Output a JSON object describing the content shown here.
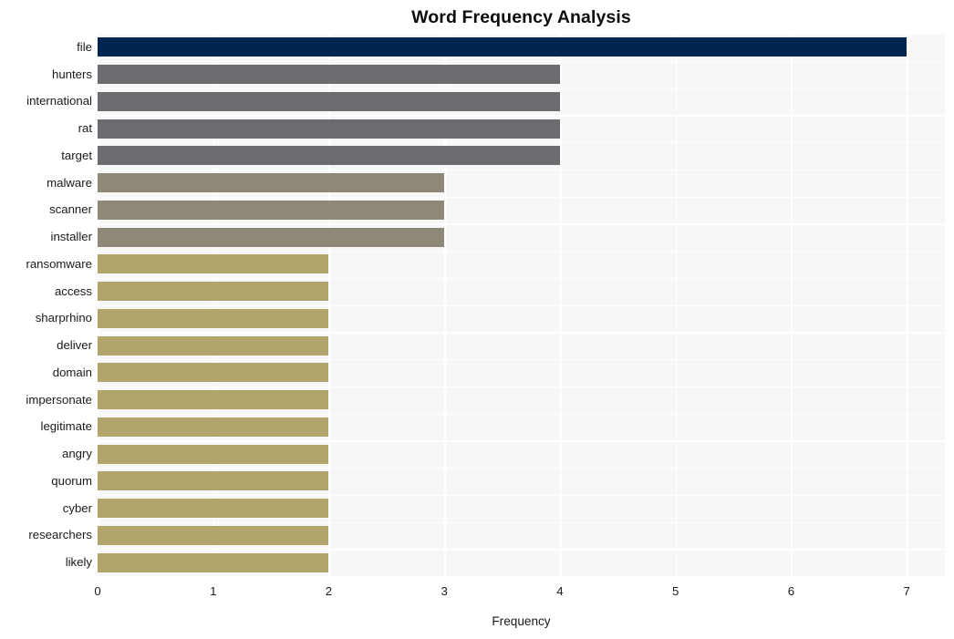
{
  "chart_data": {
    "type": "bar",
    "orientation": "horizontal",
    "title": "Word Frequency Analysis",
    "xlabel": "Frequency",
    "ylabel": "",
    "xlim": [
      0,
      7.33
    ],
    "xticks": [
      0,
      1,
      2,
      3,
      4,
      5,
      6,
      7
    ],
    "xtick_labels": [
      "0",
      "1",
      "2",
      "3",
      "4",
      "5",
      "6",
      "7"
    ],
    "grid": "vertical-and-horizontal-white-on-light-gray",
    "legend": "none",
    "categories": [
      "file",
      "hunters",
      "international",
      "rat",
      "target",
      "malware",
      "scanner",
      "installer",
      "ransomware",
      "access",
      "sharprhino",
      "deliver",
      "domain",
      "impersonate",
      "legitimate",
      "angry",
      "quorum",
      "cyber",
      "researchers",
      "likely"
    ],
    "values": [
      7,
      4,
      4,
      4,
      4,
      3,
      3,
      3,
      2,
      2,
      2,
      2,
      2,
      2,
      2,
      2,
      2,
      2,
      2,
      2
    ],
    "bar_colors": [
      "#00254f",
      "#6a6c70",
      "#6a6c70",
      "#6a6c70",
      "#6a6c70",
      "#8d8878",
      "#8d8878",
      "#8d8878",
      "#b1a56c",
      "#b1a56c",
      "#b1a56c",
      "#b1a56c",
      "#b1a56c",
      "#b1a56c",
      "#b1a56c",
      "#b1a56c",
      "#b1a56c",
      "#b1a56c",
      "#b1a56c",
      "#b1a56c"
    ]
  },
  "style": {
    "plot_background": "#f7f7f7",
    "grid_color": "#ffffff",
    "page_background": "#ffffff",
    "text_color": "#1a1a1a",
    "title_color": "#0d0d0d"
  }
}
